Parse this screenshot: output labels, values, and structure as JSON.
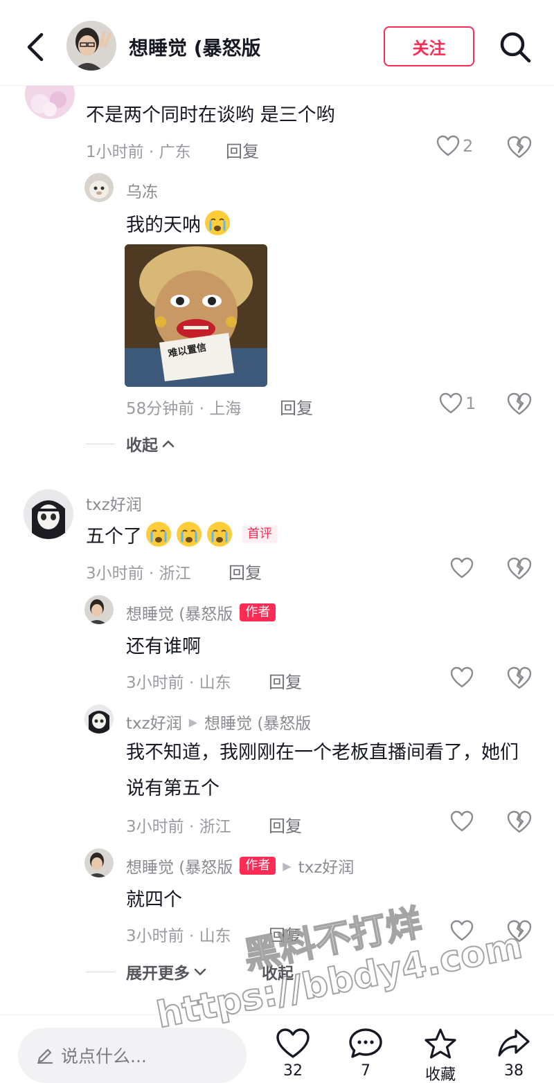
{
  "header": {
    "title": "想睡觉 (暴怒版",
    "follow_label": "关注"
  },
  "comments": [
    {
      "text": "不是两个同时在谈哟 是三个哟",
      "meta": "1小时前 · 广东",
      "reply": "回复",
      "likes": "2",
      "replies": [
        {
          "user": "乌冻",
          "text": "我的天呐",
          "meme_caption": "难以置信",
          "meta": "58分钟前 · 上海",
          "reply": "回复",
          "likes": "1"
        }
      ],
      "collapse_label": "收起"
    },
    {
      "user": "txz好润",
      "text": "五个了",
      "badge": "首评",
      "meta": "3小时前 · 浙江",
      "reply": "回复",
      "replies": [
        {
          "user": "想睡觉 (暴怒版",
          "badge": "作者",
          "text": "还有谁啊",
          "meta": "3小时前 · 山东",
          "reply": "回复"
        },
        {
          "user": "txz好润",
          "reply_to": "想睡觉 (暴怒版",
          "text": "我不知道，我刚刚在一个老板直播间看了，她们说有第五个",
          "meta": "3小时前 · 浙江",
          "reply": "回复"
        },
        {
          "user": "想睡觉 (暴怒版",
          "badge": "作者",
          "reply_to": "txz好润",
          "text": "就四个",
          "meta": "3小时前 · 山东",
          "reply": "回复"
        }
      ],
      "expand_label": "展开更多",
      "collapse_label": "收起"
    }
  ],
  "bottom_bar": {
    "input_placeholder": "说点什么...",
    "like_count": "32",
    "comment_count": "7",
    "favorite_label": "收藏",
    "share_count": "38"
  },
  "watermark": {
    "line1": "黑料不打烊",
    "line2": "https://bbdy4.com"
  },
  "colors": {
    "accent": "#fe2c55",
    "text": "#161823",
    "muted": "#9a9ba1"
  }
}
